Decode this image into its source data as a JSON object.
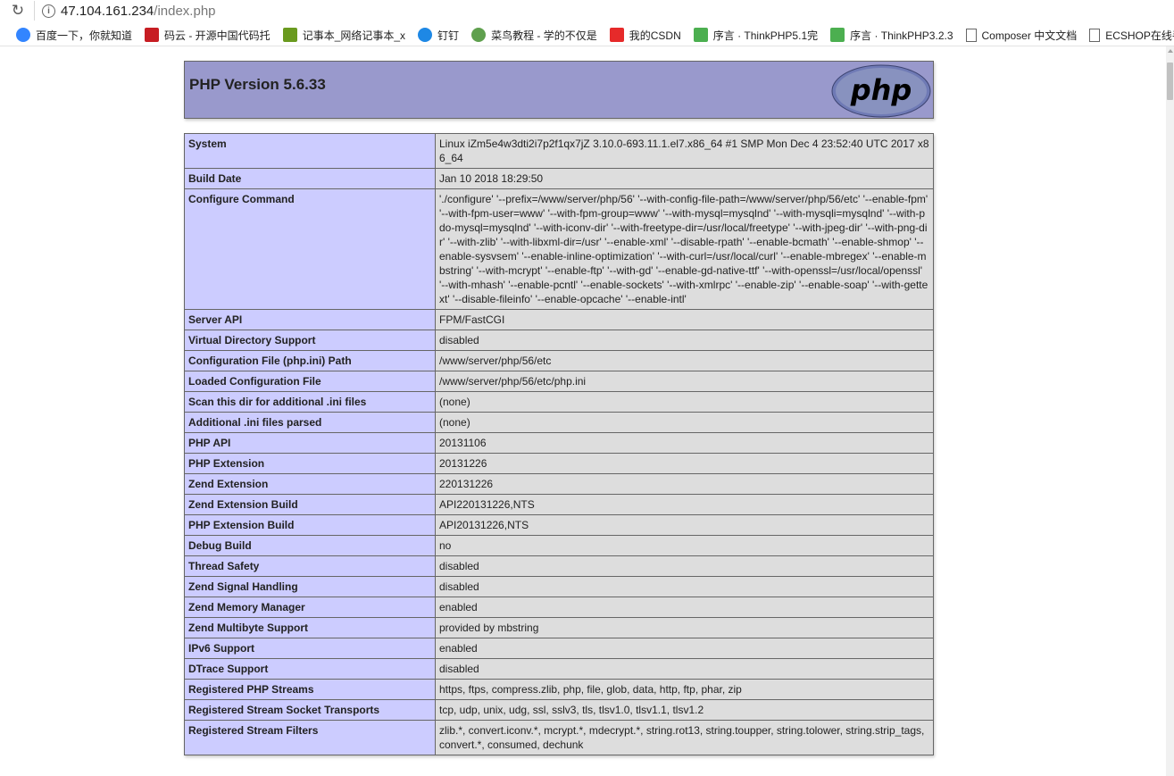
{
  "browser": {
    "url_host": "47.104.161.234",
    "url_path": "/index.php",
    "bookmarks": [
      {
        "label": "百度一下，你就知道",
        "icon": "baidu-paw-icon",
        "color": "#3385ff"
      },
      {
        "label": "码云 - 开源中国代码托",
        "icon": "gitee-g-icon",
        "color": "#c71d23"
      },
      {
        "label": "记事本_网络记事本_x",
        "icon": "notepad-n-icon",
        "color": "#6a9a1f"
      },
      {
        "label": "钉钉",
        "icon": "dingtalk-icon",
        "color": "#1e88e5"
      },
      {
        "label": "菜鸟教程 - 学的不仅是",
        "icon": "runoob-icon",
        "color": "#5fa04e"
      },
      {
        "label": "我的CSDN",
        "icon": "csdn-c-icon",
        "color": "#e62a2a"
      },
      {
        "label": "序言 · ThinkPHP5.1完",
        "icon": "thinkphp-icon",
        "color": "#4caf50"
      },
      {
        "label": "序言 · ThinkPHP3.2.3",
        "icon": "thinkphp-icon",
        "color": "#4caf50"
      },
      {
        "label": "Composer 中文文档",
        "icon": "page-icon",
        "color": "#666666"
      },
      {
        "label": "ECSHOP在线手",
        "icon": "page-icon",
        "color": "#666666"
      }
    ]
  },
  "header": {
    "title": "PHP Version 5.6.33",
    "logo_text": "php"
  },
  "rows": [
    {
      "key": "System",
      "value": "Linux iZm5e4w3dti2i7p2f1qx7jZ 3.10.0-693.11.1.el7.x86_64 #1 SMP Mon Dec 4 23:52:40 UTC 2017 x86_64"
    },
    {
      "key": "Build Date",
      "value": "Jan 10 2018 18:29:50"
    },
    {
      "key": "Configure Command",
      "value": "'./configure' '--prefix=/www/server/php/56' '--with-config-file-path=/www/server/php/56/etc' '--enable-fpm' '--with-fpm-user=www' '--with-fpm-group=www' '--with-mysql=mysqlnd' '--with-mysqli=mysqlnd' '--with-pdo-mysql=mysqlnd' '--with-iconv-dir' '--with-freetype-dir=/usr/local/freetype' '--with-jpeg-dir' '--with-png-dir' '--with-zlib' '--with-libxml-dir=/usr' '--enable-xml' '--disable-rpath' '--enable-bcmath' '--enable-shmop' '--enable-sysvsem' '--enable-inline-optimization' '--with-curl=/usr/local/curl' '--enable-mbregex' '--enable-mbstring' '--with-mcrypt' '--enable-ftp' '--with-gd' '--enable-gd-native-ttf' '--with-openssl=/usr/local/openssl' '--with-mhash' '--enable-pcntl' '--enable-sockets' '--with-xmlrpc' '--enable-zip' '--enable-soap' '--with-gettext' '--disable-fileinfo' '--enable-opcache' '--enable-intl'"
    },
    {
      "key": "Server API",
      "value": "FPM/FastCGI"
    },
    {
      "key": "Virtual Directory Support",
      "value": "disabled"
    },
    {
      "key": "Configuration File (php.ini) Path",
      "value": "/www/server/php/56/etc"
    },
    {
      "key": "Loaded Configuration File",
      "value": "/www/server/php/56/etc/php.ini"
    },
    {
      "key": "Scan this dir for additional .ini files",
      "value": "(none)"
    },
    {
      "key": "Additional .ini files parsed",
      "value": "(none)"
    },
    {
      "key": "PHP API",
      "value": "20131106"
    },
    {
      "key": "PHP Extension",
      "value": "20131226"
    },
    {
      "key": "Zend Extension",
      "value": "220131226"
    },
    {
      "key": "Zend Extension Build",
      "value": "API220131226,NTS"
    },
    {
      "key": "PHP Extension Build",
      "value": "API20131226,NTS"
    },
    {
      "key": "Debug Build",
      "value": "no"
    },
    {
      "key": "Thread Safety",
      "value": "disabled"
    },
    {
      "key": "Zend Signal Handling",
      "value": "disabled"
    },
    {
      "key": "Zend Memory Manager",
      "value": "enabled"
    },
    {
      "key": "Zend Multibyte Support",
      "value": "provided by mbstring"
    },
    {
      "key": "IPv6 Support",
      "value": "enabled"
    },
    {
      "key": "DTrace Support",
      "value": "disabled"
    },
    {
      "key": "Registered PHP Streams",
      "value": "https, ftps, compress.zlib, php, file, glob, data, http, ftp, phar, zip"
    },
    {
      "key": "Registered Stream Socket Transports",
      "value": "tcp, udp, unix, udg, ssl, sslv3, tls, tlsv1.0, tlsv1.1, tlsv1.2"
    },
    {
      "key": "Registered Stream Filters",
      "value": "zlib.*, convert.iconv.*, mcrypt.*, mdecrypt.*, string.rot13, string.toupper, string.tolower, string.strip_tags, convert.*, consumed, dechunk"
    }
  ]
}
